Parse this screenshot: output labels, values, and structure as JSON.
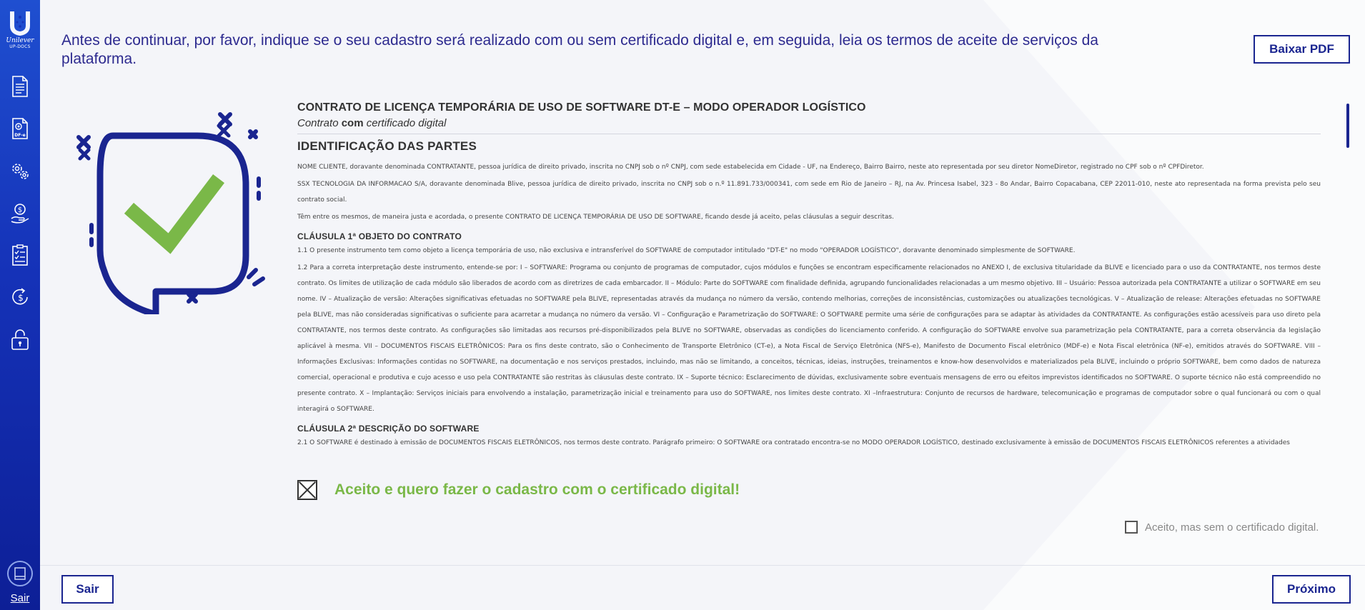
{
  "sidebar": {
    "logo": {
      "brand": "Unilever",
      "sub": "UP-DOCS"
    },
    "items": [
      {
        "icon": "document-icon"
      },
      {
        "icon": "dfe-document-icon",
        "badge": "DF-e"
      },
      {
        "icon": "settings-gears-icon"
      },
      {
        "icon": "money-hand-icon"
      },
      {
        "icon": "clipboard-checklist-icon"
      },
      {
        "icon": "dollar-refresh-icon"
      },
      {
        "icon": "padlock-icon"
      }
    ],
    "exit_label": "Sair"
  },
  "header": {
    "intro_text": "Antes de continuar, por favor, indique se o seu cadastro será realizado com ou sem certificado digital e, em seguida, leia os termos de aceite de serviços da plataforma.",
    "download_pdf_label": "Baixar PDF"
  },
  "colors": {
    "primary": "#1a2590",
    "accent_green": "#7ab848",
    "sidebar": "#1532b8"
  },
  "contract": {
    "title": "CONTRATO DE LICENÇA TEMPORÁRIA DE USO DE SOFTWARE DT-E – MODO OPERADOR LOGÍSTICO",
    "subtitle_prefix": "Contrato ",
    "subtitle_bold": "com",
    "subtitle_suffix": " certificado digital",
    "section_heading": "IDENTIFICAÇÃO DAS PARTES",
    "p1": "NOME CLIENTE, doravante denominada CONTRATANTE, pessoa jurídica de direito privado, inscrita no CNPJ sob o nº CNPJ, com sede estabelecida em Cidade - UF, na Endereço, Bairro Bairro, neste ato representada por seu diretor NomeDiretor, registrado no CPF sob o nº CPFDiretor.",
    "p2": "SSX TECNOLOGIA DA INFORMACAO S/A, doravante denominada Blive, pessoa jurídica de direito privado, inscrita no CNPJ sob o n.º 11.891.733/000341, com sede em Rio de Janeiro – RJ, na Av. Princesa Isabel, 323 - 8o Andar, Bairro Copacabana, CEP 22011-010, neste ato representada na forma prevista pelo seu contrato social.",
    "p3": "Têm entre os mesmos, de maneira justa e acordada, o presente CONTRATO DE LICENÇA TEMPORÁRIA DE USO DE SOFTWARE, ficando desde já aceito, pelas cláusulas a seguir descritas.",
    "clause1_title": "CLÁUSULA 1ª OBJETO DO CONTRATO",
    "clause1_p1": "1.1 O presente instrumento tem como objeto a licença temporária de uso, não exclusiva e intransferível do SOFTWARE de computador intitulado \"DT-E\" no modo \"OPERADOR LOGÍSTICO\", doravante denominado simplesmente de SOFTWARE.",
    "clause1_p2": "1.2 Para a correta interpretação deste instrumento, entende-se por: I – SOFTWARE: Programa ou conjunto de programas de computador, cujos módulos e funções se encontram especificamente relacionados no ANEXO I, de exclusiva titularidade da BLIVE e licenciado para o uso da CONTRATANTE, nos termos deste contrato. Os limites de utilização de cada módulo são liberados de acordo com as diretrizes de cada embarcador. II – Módulo: Parte do SOFTWARE com finalidade definida, agrupando funcionalidades relacionadas a um mesmo objetivo. III – Usuário: Pessoa autorizada pela CONTRATANTE a utilizar o SOFTWARE em seu nome. IV – Atualização de versão: Alterações significativas efetuadas no SOFTWARE pela BLIVE, representadas através da mudança no número da versão, contendo melhorias, correções de inconsistências, customizações ou atualizações tecnológicas. V – Atualização de release: Alterações efetuadas no SOFTWARE pela BLIVE, mas não consideradas significativas o suficiente para acarretar a mudança no número da versão. VI – Configuração e Parametrização do SOFTWARE: O SOFTWARE permite uma série de configurações para se adaptar às atividades da CONTRATANTE. As configurações estão acessíveis para uso direto pela CONTRATANTE, nos termos deste contrato. As configurações são limitadas aos recursos pré-disponibilizados pela BLIVE no SOFTWARE, observadas as condições do licenciamento conferido. A configuração do SOFTWARE envolve sua parametrização pela CONTRATANTE, para a correta observância da legislação aplicável à mesma. VII – DOCUMENTOS FISCAIS ELETRÔNICOS: Para os fins deste contrato, são o Conhecimento de Transporte Eletrônico (CT-e), a Nota Fiscal de Serviço Eletrônica (NFS-e), Manifesto de Documento Fiscal eletrônico (MDF-e) e Nota Fiscal eletrônica (NF-e), emitidos através do SOFTWARE. VIII – Informações Exclusivas: Informações contidas no SOFTWARE, na documentação e nos serviços prestados, incluindo, mas não se limitando, a conceitos, técnicas, ideias, instruções, treinamentos e know-how desenvolvidos e materializados pela BLIVE, incluindo o próprio SOFTWARE, bem como dados de natureza comercial, operacional e produtiva e cujo acesso e uso pela CONTRATANTE são restritas às cláusulas deste contrato. IX – Suporte técnico: Esclarecimento de dúvidas, exclusivamente sobre eventuais mensagens de erro ou efeitos imprevistos identificados no SOFTWARE. O suporte técnico não está compreendido no presente contrato. X – Implantação: Serviços iniciais para envolvendo a instalação, parametrização inicial e treinamento para uso do SOFTWARE, nos limites deste contrato. XI –Infraestrutura: Conjunto de recursos de hardware, telecomunicação e programas de computador sobre o qual funcionará ou com o qual interagirá o SOFTWARE.",
    "clause2_title": "CLÁUSULA 2ª DESCRIÇÃO DO SOFTWARE",
    "clause2_p1": "2.1 O SOFTWARE é destinado à emissão de DOCUMENTOS FISCAIS ELETRÔNICOS, nos termos deste contrato. Parágrafo primeiro: O SOFTWARE ora contratado encontra-se no MODO OPERADOR LOGÍSTICO, destinado exclusivamente à emissão de DOCUMENTOS FISCAIS ELETRÔNICOS referentes a atividades"
  },
  "accept": {
    "with_certificate_label": "Aceito e quero fazer o cadastro com o certificado digital!",
    "with_certificate_checked": true,
    "without_certificate_label": "Aceito, mas sem o certificado digital.",
    "without_certificate_checked": false
  },
  "footer": {
    "exit_label": "Sair",
    "next_label": "Próximo"
  }
}
